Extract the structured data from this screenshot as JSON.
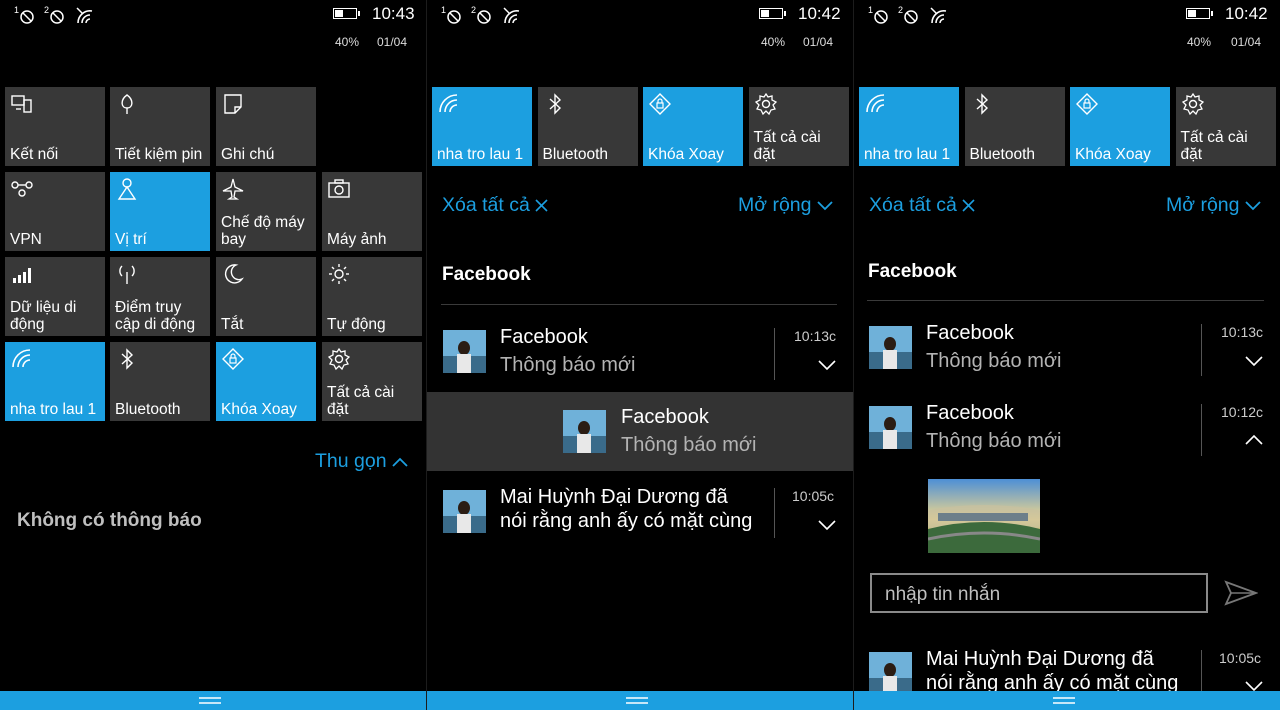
{
  "status": {
    "p1": {
      "time": "10:43",
      "battery": "40%",
      "date": "01/04",
      "battery_level": 0.4
    },
    "p2": {
      "time": "10:42",
      "battery": "40%",
      "date": "01/04",
      "battery_level": 0.4
    },
    "p3": {
      "time": "10:42",
      "battery": "40%",
      "date": "01/04",
      "battery_level": 0.4
    },
    "sim_labels": [
      "1",
      "2"
    ],
    "icons": [
      "sim1-no-signal-icon",
      "sim2-no-signal-icon",
      "wifi-off-icon"
    ]
  },
  "quick_actions_full": [
    {
      "label": "Kết nối",
      "icon": "connect-icon",
      "on": false
    },
    {
      "label": "Tiết kiệm pin",
      "icon": "battery-saver-icon",
      "on": false
    },
    {
      "label": "Ghi chú",
      "icon": "note-icon",
      "on": false
    },
    {
      "label": "VPN",
      "icon": "vpn-icon",
      "on": false
    },
    {
      "label": "Vị trí",
      "icon": "location-icon",
      "on": true
    },
    {
      "label": "Chế độ máy bay",
      "icon": "airplane-icon",
      "on": false
    },
    {
      "label": "Máy ảnh",
      "icon": "camera-icon",
      "on": false
    },
    {
      "label": "Dữ liệu di động",
      "icon": "cellular-data-icon",
      "on": false
    },
    {
      "label": "Điểm truy cập di động",
      "icon": "hotspot-icon",
      "on": false
    },
    {
      "label": "Tắt",
      "icon": "moon-icon",
      "on": false
    },
    {
      "label": "Tự động",
      "icon": "brightness-icon",
      "on": false
    },
    {
      "label": "nha tro lau 1",
      "icon": "wifi-icon",
      "on": true
    },
    {
      "label": "Bluetooth",
      "icon": "bluetooth-icon",
      "on": false
    },
    {
      "label": "Khóa Xoay",
      "icon": "rotation-lock-icon",
      "on": true
    },
    {
      "label": "Tất cả cài đặt",
      "icon": "gear-icon",
      "on": false
    }
  ],
  "quick_actions_row": [
    {
      "label": "nha tro lau 1",
      "icon": "wifi-icon",
      "on": true
    },
    {
      "label": "Bluetooth",
      "icon": "bluetooth-icon",
      "on": false
    },
    {
      "label": "Khóa Xoay",
      "icon": "rotation-lock-icon",
      "on": true
    },
    {
      "label": "Tất cả cài đặt",
      "icon": "gear-icon",
      "on": false
    }
  ],
  "collapse_label": "Thu gọn",
  "no_notifications": "Không có thông báo",
  "clear_all_label": "Xóa tất cả",
  "expand_label": "Mở rộng",
  "group_name": "Facebook",
  "notifications_p2": [
    {
      "title": "Facebook",
      "body": "Thông báo mới",
      "time": "10:13c"
    },
    {
      "title": "Facebook",
      "body": "Thông báo mới",
      "time": ""
    },
    {
      "title": "Mai Huỳnh Đại Dương đã",
      "body": "nói rằng anh ấy có mặt cùng",
      "time": "10:05c"
    }
  ],
  "notifications_p3": [
    {
      "title": "Facebook",
      "body": "Thông báo mới",
      "time": "10:13c"
    },
    {
      "title": "Facebook",
      "body": "Thông báo mới",
      "time": "10:12c"
    },
    {
      "title": "Mai Huỳnh Đại Dương đã",
      "body": "nói rằng anh ấy có mặt cùng",
      "time": "10:05c"
    }
  ],
  "reply_placeholder": "nhập tin nhắn",
  "colors": {
    "accent": "#1c9fe0",
    "tile": "#383838",
    "background": "#000000"
  }
}
